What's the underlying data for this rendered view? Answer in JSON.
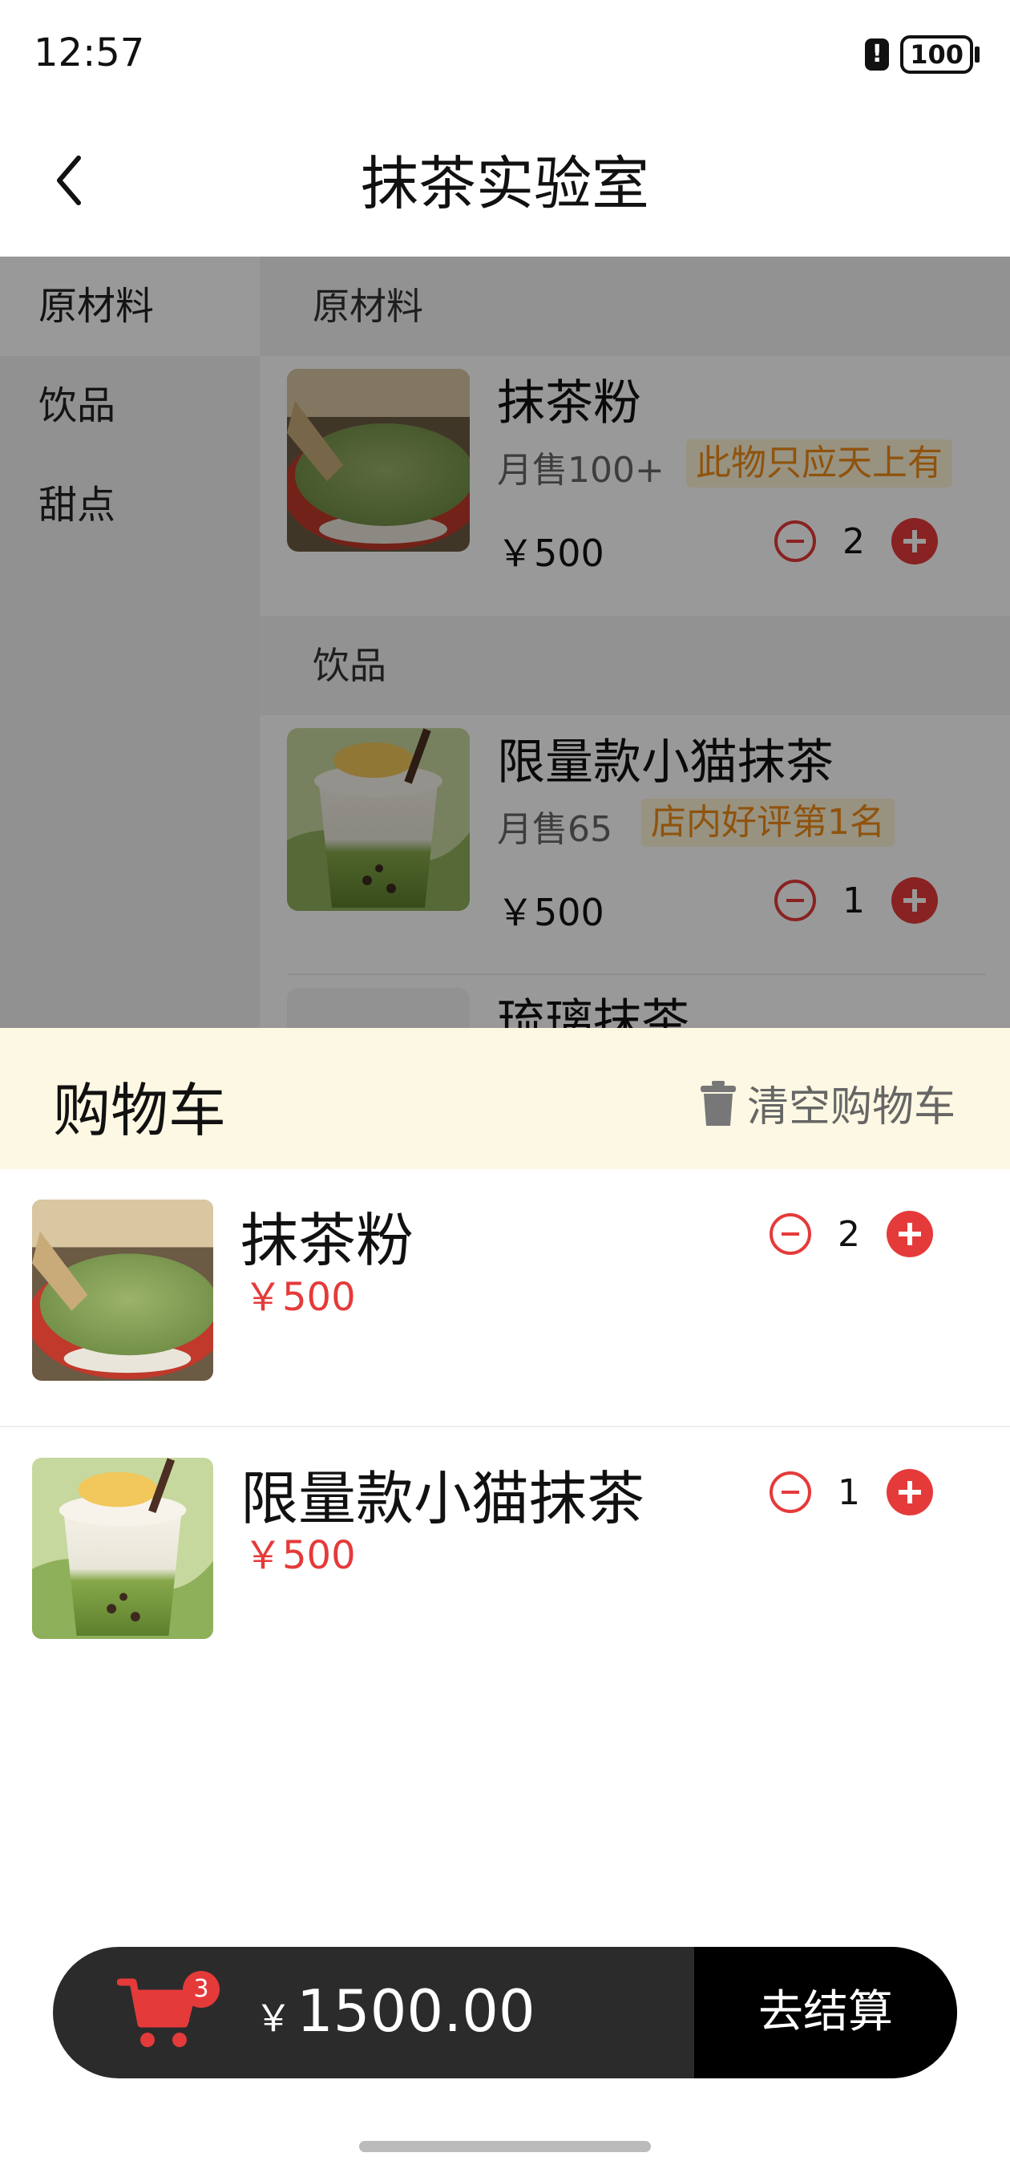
{
  "status_bar": {
    "time": "12:57",
    "battery": "100"
  },
  "header": {
    "title": "抹茶实验室"
  },
  "categories": [
    {
      "label": "原材料",
      "active": true
    },
    {
      "label": "饮品",
      "active": false
    },
    {
      "label": "甜点",
      "active": false
    }
  ],
  "menu": {
    "sections": [
      {
        "title": "原材料",
        "products": [
          {
            "name": "抹茶粉",
            "sales": "月售100+",
            "tag": "此物只应天上有",
            "price": "￥500",
            "qty": "2"
          }
        ]
      },
      {
        "title": "饮品",
        "products": [
          {
            "name": "限量款小猫抹茶",
            "sales": "月售65",
            "tag": "店内好评第1名",
            "price": "￥500",
            "qty": "1"
          },
          {
            "name": "琉璃抹茶"
          }
        ]
      }
    ]
  },
  "cart": {
    "title": "购物车",
    "clear_label": "清空购物车",
    "items": [
      {
        "name": "抹茶粉",
        "price": "￥500",
        "qty": "2"
      },
      {
        "name": "限量款小猫抹茶",
        "price": "￥500",
        "qty": "1"
      }
    ]
  },
  "checkout": {
    "count": "3",
    "currency": "￥",
    "total": "1500.00",
    "button_label": "去结算"
  },
  "colors": {
    "accent": "#e53a3a",
    "tag_text": "#ee8a16",
    "tag_bg": "#fdf3d6",
    "cart_header_bg": "#fdf8e3"
  }
}
